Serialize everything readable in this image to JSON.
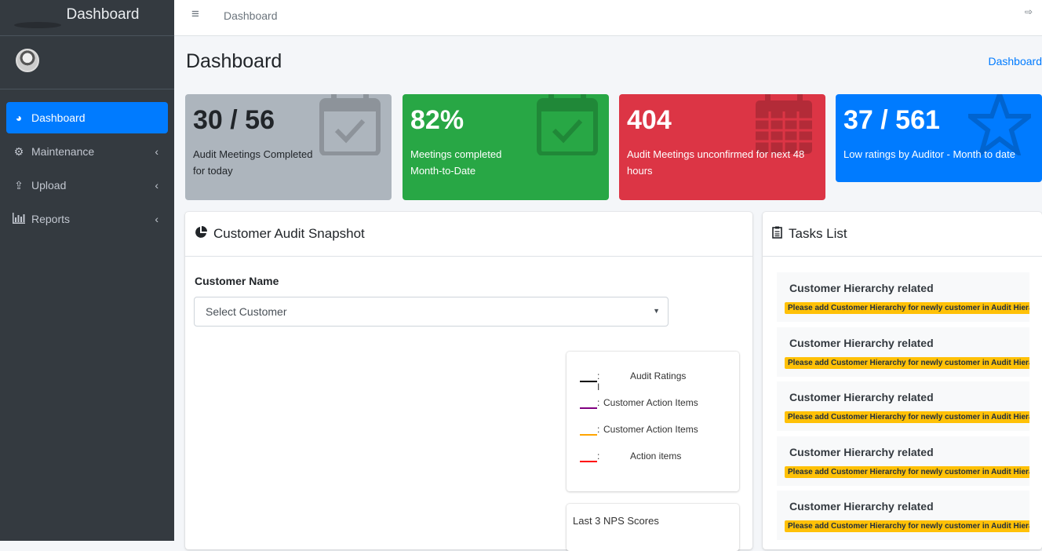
{
  "sidebar": {
    "brand": "Dashboard",
    "items": [
      {
        "label": "Dashboard",
        "icon": "tachometer-icon",
        "active": true
      },
      {
        "label": "Maintenance",
        "icon": "cogs-icon"
      },
      {
        "label": "Upload",
        "icon": "upload-icon"
      },
      {
        "label": "Reports",
        "icon": "bar-chart-icon"
      }
    ]
  },
  "topbar": {
    "breadcrumb": "Dashboard"
  },
  "header": {
    "title": "Dashboard",
    "breadcrumb": "Dashboard"
  },
  "stats": [
    {
      "value": "30 / 56",
      "label": "Audit Meetings Completed for today",
      "color": "#adb5bd",
      "icon": "calendar-check-icon"
    },
    {
      "value": "82%",
      "label": "Meetings completed Month-to-Date",
      "color": "#28a745",
      "icon": "calendar-check-icon"
    },
    {
      "value": "404",
      "label": "Audit Meetings unconfirmed for next 48 hours",
      "color": "#dc3545",
      "icon": "calendar-icon"
    },
    {
      "value": "37 / 561",
      "label": "Low ratings by Auditor - Month to date",
      "color": "#007bff",
      "icon": "star-icon"
    }
  ],
  "snapshot": {
    "title": "Customer Audit Snapshot",
    "customer_label": "Customer Name",
    "select_value": "Select Customer",
    "legend": [
      {
        "colon": ": I",
        "text": "Audit Ratings",
        "color": "#000000"
      },
      {
        "colon": ":",
        "text": "Customer Action Items",
        "color": "#800080"
      },
      {
        "colon": ":",
        "text": "Customer Action Items",
        "color": "#ffa500"
      },
      {
        "colon": ":",
        "text": "Action items",
        "color": "#ff0000"
      }
    ],
    "nps_title": "Last 3 NPS Scores"
  },
  "tasks": {
    "title": "Tasks List",
    "items": [
      {
        "title": "Customer Hierarchy related",
        "badge": "Please add Customer Hierarchy for newly customer in Audit Hierarchy"
      },
      {
        "title": "Customer Hierarchy related",
        "badge": "Please add Customer Hierarchy for newly customer in Audit Hierarchy"
      },
      {
        "title": "Customer Hierarchy related",
        "badge": "Please add Customer Hierarchy for newly customer in Audit Hierarchy"
      },
      {
        "title": "Customer Hierarchy related",
        "badge": "Please add Customer Hierarchy for newly customer in Audit Hierarchy"
      },
      {
        "title": "Customer Hierarchy related",
        "badge": "Please add Customer Hierarchy for newly customer in Audit Hierarchy"
      }
    ]
  }
}
